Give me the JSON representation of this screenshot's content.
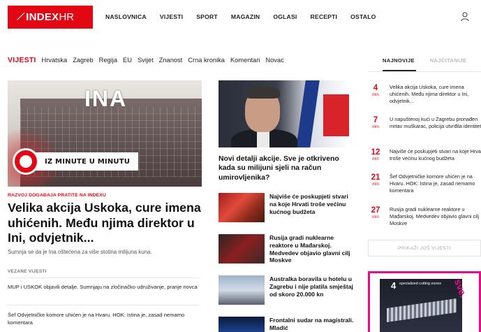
{
  "header": {
    "logo": {
      "brand_bold": "INDEX",
      "brand_light": "HR"
    },
    "nav": [
      "NASLOVNICA",
      "VIJESTI",
      "SPORT",
      "MAGAZIN",
      "OGLASI",
      "RECEPTI",
      "OSTALO"
    ]
  },
  "section_nav": {
    "title": "VIJESTI",
    "items": [
      "Hrvatska",
      "Zagreb",
      "Regija",
      "EU",
      "Svijet",
      "Znanost",
      "Crna kronika",
      "Komentari",
      "Novac"
    ]
  },
  "side_tabs": {
    "active": "NAJNOVIJE",
    "inactive": "NAJČITANIJE"
  },
  "hero": {
    "image_text": "INA",
    "badge": "IZ MINUTE U MINUTU",
    "kicker": "RAZVOJ DOGAĐAJA PRATITE NA INDEXU",
    "title": "Velika akcija Uskoka, cure imena uhićenih. Među njima direktor u Ini, odvjetnik...",
    "lead": "Sumnja se da je Ina oštećena za više stotina milijuna kuna.",
    "related_heading": "VEZANE VIJESTI",
    "related": [
      "MUP i USKOK objavili detalje. Sumnjaju na zločinačko udruživanje, pranje novca",
      "Šef Odvjetničke komore uhićen je na Hvaru. HOK: Istina je, zasad nemamo komentara"
    ]
  },
  "middle": {
    "main_title": "Novi detalji akcije. Sve je otkriveno kada su milijuni sjeli na račun umirovljenika?",
    "items": [
      {
        "title": "Najviše će poskupjeti stvari na koje Hrvati troše većinu kućnog budžeta"
      },
      {
        "title": "Rusija gradi nuklearne reaktore u Mađarskoj. Medvedev objavio glavni cilj Moskve"
      },
      {
        "title": "Australka boravila u hotelu u Zagrebu i nije platila smještaj od skoro 20.000 kn"
      },
      {
        "title": "Frontalni sudar na magistrali. Mladić"
      }
    ]
  },
  "latest": {
    "unit": "min",
    "items": [
      {
        "minutes": "4",
        "title": "Velika akcija Uskoka, cure imena uhićenih. Među njima direktor u Ini, odvjetnik..."
      },
      {
        "minutes": "7",
        "title": "U napuštenoj kući u Zagrebu pronađen mrtav muškarac, policija utvrđila identitet"
      },
      {
        "minutes": "12",
        "title": "Najviše će poskupjeti stvari na koje Hrvati troše većinu kućnog budžeta"
      },
      {
        "minutes": "21",
        "title": "Šef Odvjetničke komore uhićen je na Hvaru. HOK: Istina je, zasad nemamo komentara"
      },
      {
        "minutes": "27",
        "title": "Rusija gradi nuklearne reaktore u Mađarskoj. Medvedev objavio glavni cilj Moskve"
      }
    ],
    "more_label": "PRIKAŽI JOŠ VIJESTI"
  },
  "ad": {
    "number": "4",
    "text": "specialized cutting zones",
    "brand": "sve."
  },
  "colors": {
    "brand_red": "#e30613",
    "ad_pink": "#e90a8a"
  }
}
